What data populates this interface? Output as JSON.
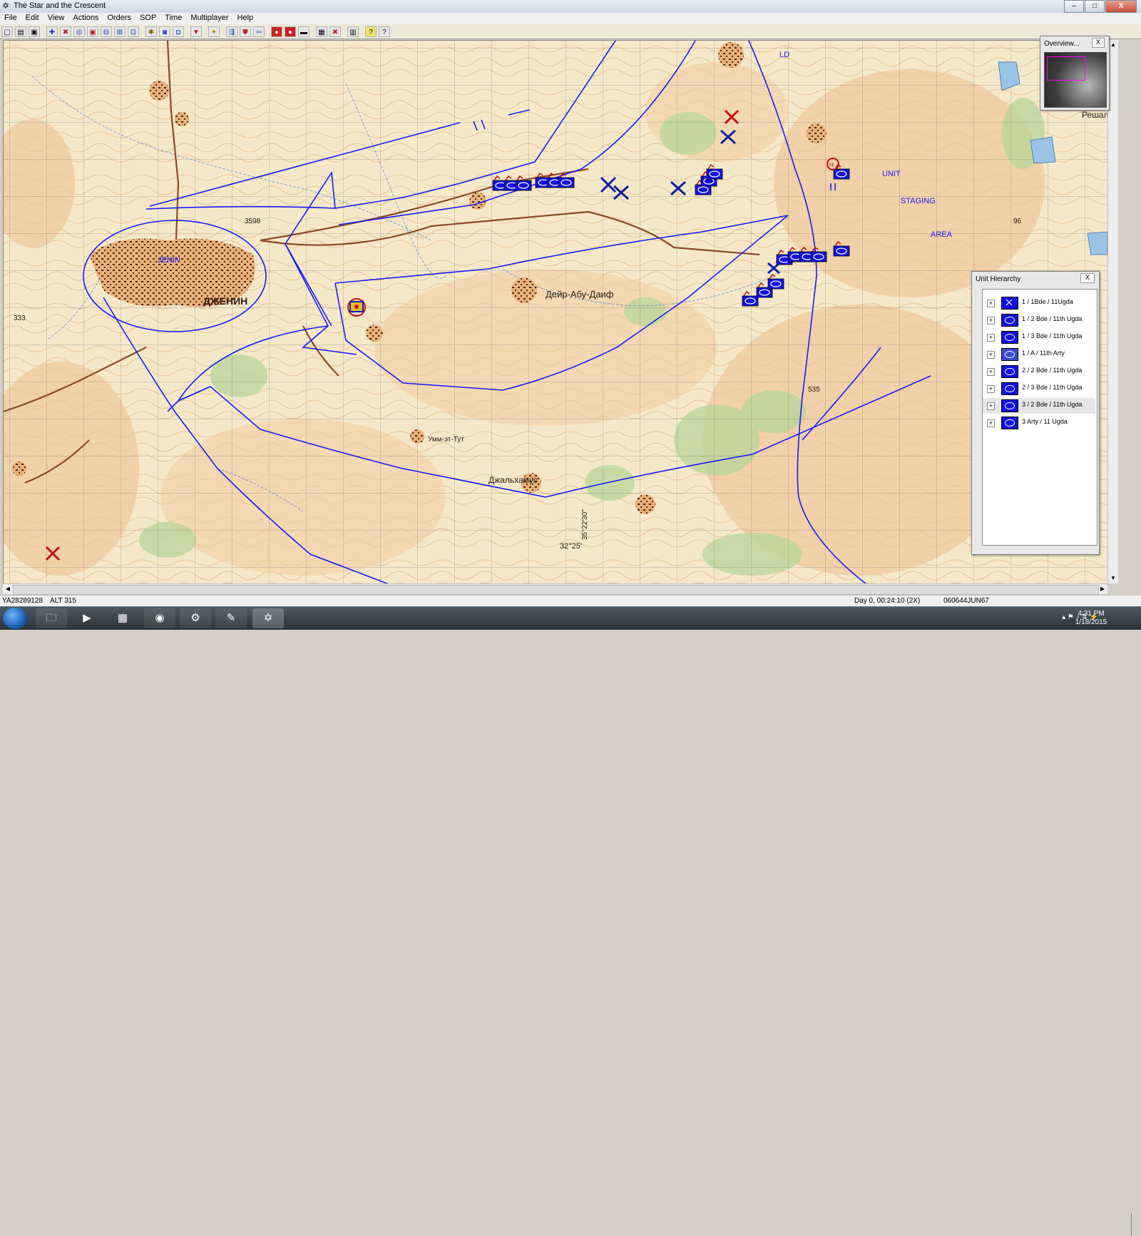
{
  "window": {
    "title": "The Star and the Crescent",
    "min": "–",
    "max": "□",
    "close": "X"
  },
  "menu": [
    "File",
    "Edit",
    "View",
    "Actions",
    "Orders",
    "SOP",
    "Time",
    "Multiplayer",
    "Help"
  ],
  "toolbar_icons": [
    "new-icon",
    "open-icon",
    "save-icon",
    "zoom-in-icon",
    "zoom-out-icon",
    "zoom-fit-icon",
    "unit-icon",
    "hq-icon",
    "formation-icon",
    "formation2-icon",
    "arty-icon",
    "air-icon",
    "info-icon",
    "filter-icon",
    "assault-icon",
    "move-icon",
    "defend-icon",
    "withdraw-icon",
    "halt-icon",
    "stop-icon",
    "cancel-icon",
    "report-icon",
    "delete-icon",
    "options-icon",
    "help-icon",
    "context-help-icon"
  ],
  "map": {
    "city_latin": "JENIN",
    "city_cyrillic": "ДЖЕНИН",
    "town_deir": "Дейр-Абу-Даиф",
    "town_jalamus": "Джальхамус",
    "town_umm": "Умм-эт-Тут",
    "staging_unit": "UNIT",
    "staging_staging": "STAGING",
    "staging_area": "AREA",
    "ld_label": "LD",
    "grid_cross": "32°25'",
    "lon_label": "35°22'30\"",
    "edge_label": "Решал",
    "spot_333": "333",
    "spot_3598": "3598",
    "spot_535": "535",
    "spot_96": "96",
    "line_color": "#1a1aff",
    "friendly_color": "#1010e0",
    "enemy_color": "#c01010"
  },
  "overview": {
    "title": "Overview...",
    "close": "X"
  },
  "hierarchy": {
    "title": "Unit Hierarchy",
    "close": "X",
    "units": [
      {
        "label": "1 / 1Bde / 11Ugda",
        "icon": "hq-x-icon"
      },
      {
        "label": "1 / 2 Bde / 11th Ugda",
        "icon": "armor-icon"
      },
      {
        "label": "1 / 3 Bde / 11th Ugda",
        "icon": "armor-icon"
      },
      {
        "label": "1 / A / 11th Arty",
        "icon": "artillery-icon"
      },
      {
        "label": "2 / 2 Bde / 11th Ugda",
        "icon": "armor-icon"
      },
      {
        "label": "2 / 3 Bde / 11th Ugda",
        "icon": "armor-icon"
      },
      {
        "label": "3 / 2 Bde / 11th Ugda",
        "icon": "armor-icon"
      },
      {
        "label": "3 Arty / 11 Ugda",
        "icon": "artillery-icon"
      }
    ]
  },
  "status": {
    "grid_ref": "YA28289128",
    "alt": "ALT  315",
    "time": "Day 0, 00:24:10 (2X)",
    "dtg": "060644JUN67"
  },
  "taskbar": {
    "clock_time": "4:31 PM",
    "clock_date": "1/18/2015",
    "apps": [
      "explorer-icon",
      "media-player-icon",
      "apps-icon",
      "chrome-icon",
      "steam-icon",
      "acrobat-icon",
      "star-crescent-icon"
    ]
  }
}
